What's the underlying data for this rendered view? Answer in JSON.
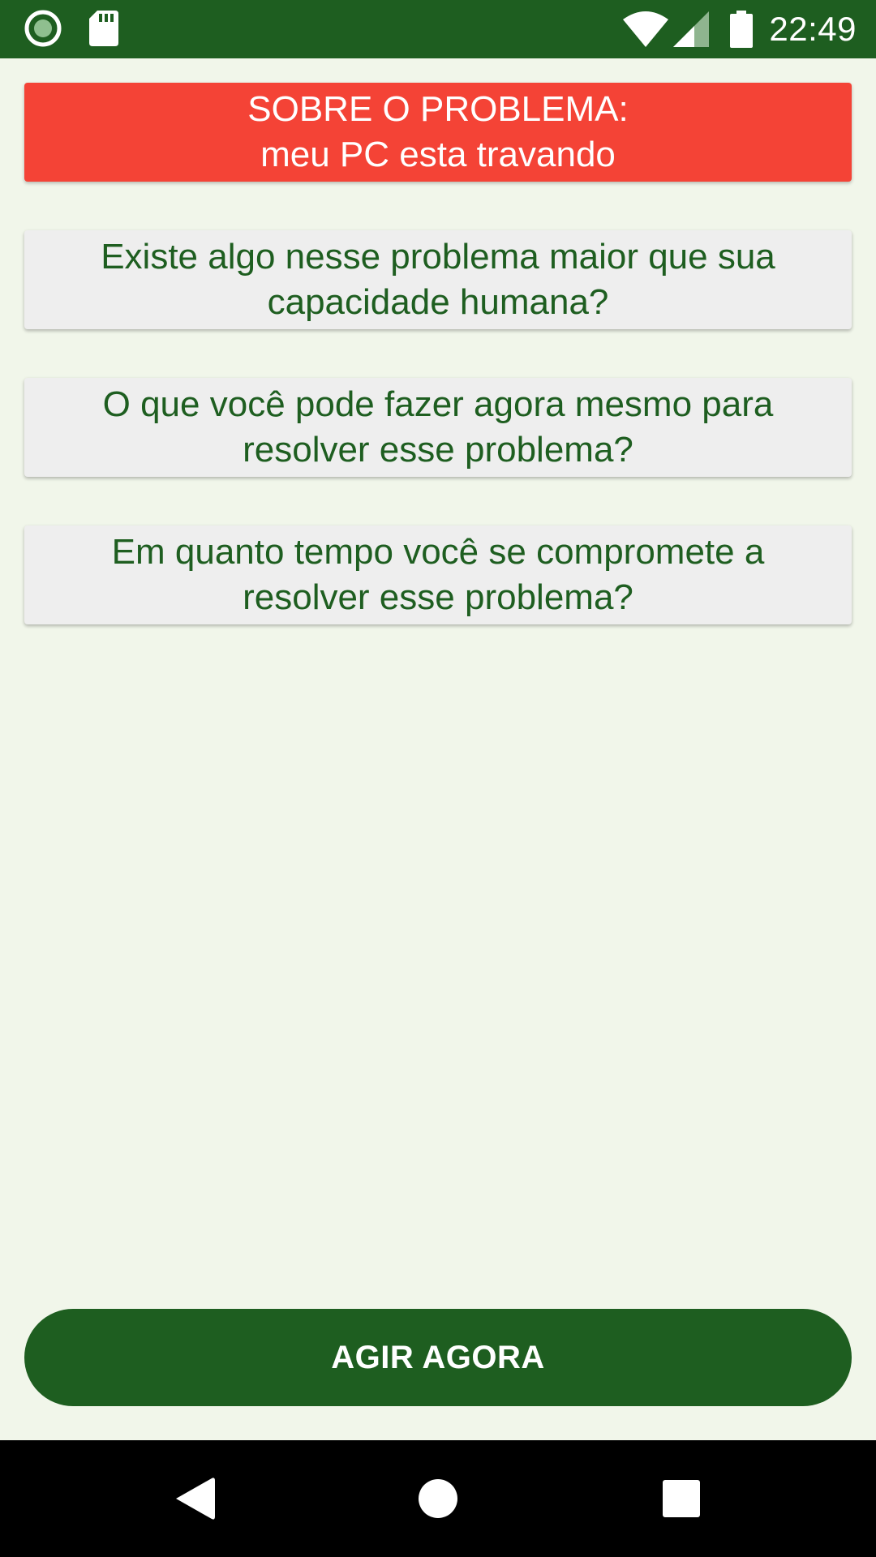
{
  "status_bar": {
    "time": "22:49",
    "icons": [
      "record-icon",
      "sd-card-icon",
      "wifi-icon",
      "cell-signal-icon",
      "battery-icon"
    ],
    "color": "#1e5e20"
  },
  "problem": {
    "heading": "SOBRE O PROBLEMA:",
    "description": "meu PC esta travando",
    "color": "#f44336"
  },
  "questions": [
    {
      "label": "Existe algo nesse problema maior que sua capacidade humana?"
    },
    {
      "label": "O que você pode fazer agora mesmo para resolver esse problema?"
    },
    {
      "label": "Em quanto tempo você se compromete a resolver esse problema?"
    }
  ],
  "action": {
    "label": "AGIR AGORA",
    "color": "#1e5e20"
  },
  "nav_bar": {
    "icons": [
      "back-icon",
      "home-icon",
      "recents-icon"
    ]
  },
  "colors": {
    "background": "#f1f6ea",
    "text_accent": "#1e5e20",
    "button_background": "#eeeeee"
  }
}
